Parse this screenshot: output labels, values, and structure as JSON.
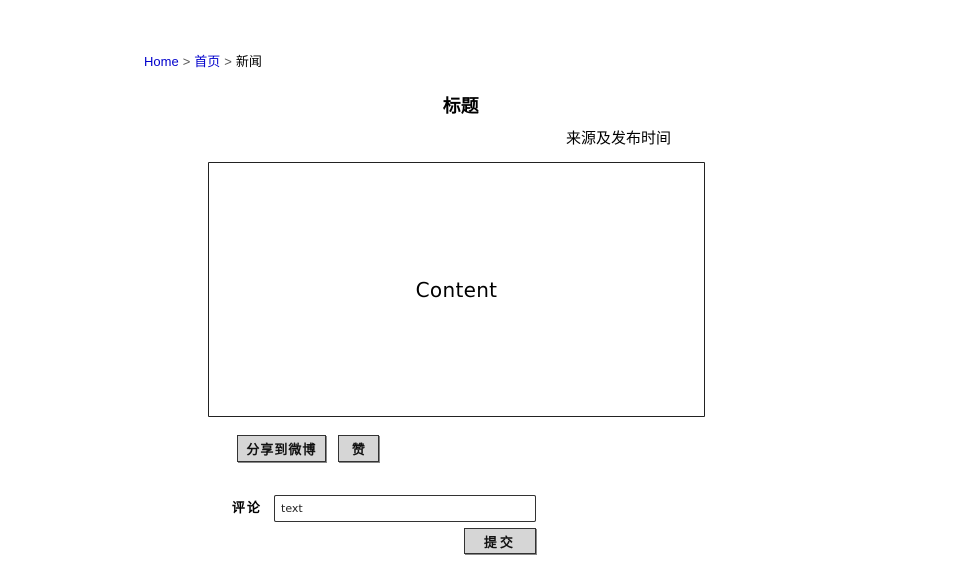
{
  "breadcrumb": {
    "home": "Home",
    "sep1": ">",
    "index": "首页",
    "sep2": ">",
    "current": "新闻"
  },
  "article": {
    "title": "标题",
    "source_time": "来源及发布时间",
    "content": "Content"
  },
  "actions": {
    "share_label": "分享到微博",
    "like_label": "赞"
  },
  "comment": {
    "label": "评论",
    "input_value": "text",
    "submit_label": "提交"
  }
}
